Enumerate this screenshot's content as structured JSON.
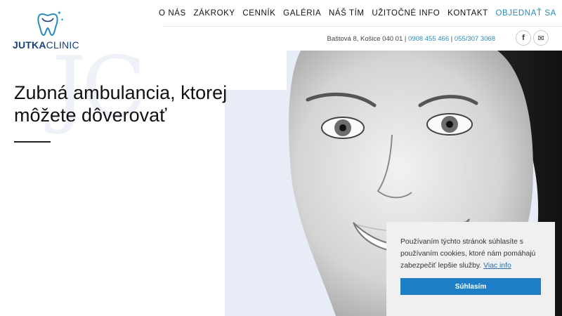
{
  "brand": {
    "bold": "JUTKA",
    "light": "CLINIC"
  },
  "nav": {
    "items": [
      "O NÁS",
      "ZÁKROKY",
      "CENNÍK",
      "GALÉRIA",
      "NÁŠ TÍM",
      "UŽITOČNÉ INFO",
      "KONTAKT"
    ],
    "cta": "OBJEDNAŤ SA"
  },
  "contact": {
    "address": "Baštová 8, Košice 040 01",
    "sep1": " | ",
    "phone1": "0908 455 466",
    "sep2": " | ",
    "phone2": "055/307 3068"
  },
  "social": {
    "facebook": "f",
    "email": "✉"
  },
  "hero": {
    "watermark": "JC",
    "line1": "Zubná ambulancia, ktorej",
    "line2": "môžete dôverovať"
  },
  "cookie": {
    "text": "Používaním týchto stránok súhlasíte s používaním cookies, ktoré nám pomáhajú zabezpečiť lepšie služby.",
    "more": "Viac info",
    "button": "Súhlasím"
  },
  "colors": {
    "accent": "#2a8ab8",
    "brand": "#1b3f7a",
    "cookie_button": "#1f7fc6",
    "hero_bg": "#e8ecf6"
  }
}
